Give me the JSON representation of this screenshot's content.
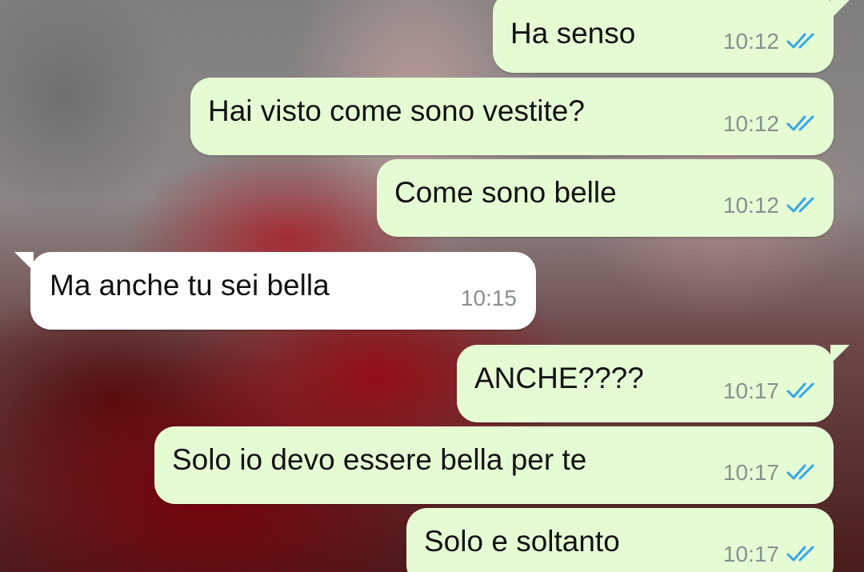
{
  "messages": [
    {
      "direction": "out",
      "text": "Ha senso",
      "time": "10:12",
      "ticks": "double-check-read-icon",
      "first_of_group": true
    },
    {
      "direction": "out",
      "text": "Hai visto come sono vestite?",
      "time": "10:12",
      "ticks": "double-check-read-icon",
      "first_of_group": false
    },
    {
      "direction": "out",
      "text": "Come sono belle",
      "time": "10:12",
      "ticks": "double-check-read-icon",
      "first_of_group": false
    },
    {
      "direction": "in",
      "text": "Ma anche tu sei bella",
      "time": "10:15",
      "first_of_group": true
    },
    {
      "direction": "out",
      "text": "ANCHE????",
      "time": "10:17",
      "ticks": "double-check-read-icon",
      "first_of_group": true
    },
    {
      "direction": "out",
      "text": "Solo io devo essere bella per te",
      "time": "10:17",
      "ticks": "double-check-read-icon",
      "first_of_group": false
    },
    {
      "direction": "out",
      "text": "Solo e soltanto",
      "time": "10:17",
      "ticks": "double-check-read-icon",
      "first_of_group": false
    }
  ],
  "colors": {
    "outgoing_bubble": "#e5fbd4",
    "incoming_bubble": "#ffffff",
    "timestamp": "#8a8f8f",
    "read_ticks": "#35a7e8",
    "text": "#121212"
  }
}
